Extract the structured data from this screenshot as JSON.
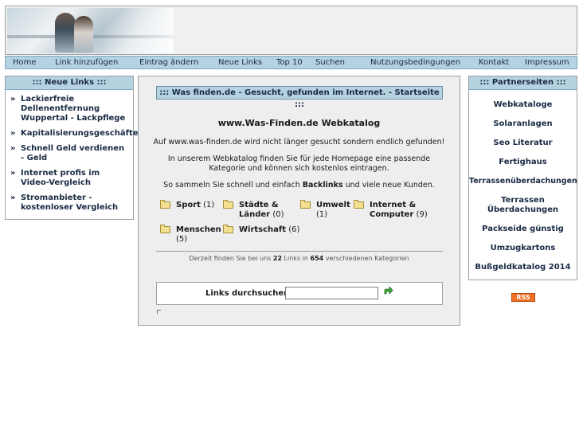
{
  "nav": {
    "items": [
      "Home",
      "Link hinzufügen",
      "Eintrag ändern",
      "Neue Links",
      "Top 10",
      "Suchen",
      "Nutzungsbedingungen",
      "Kontakt",
      "Impressum"
    ]
  },
  "left_panel": {
    "title": "::: Neue Links :::",
    "items": [
      "Lackierfreie Dellenentfernung Wuppertal - Lackpflege",
      "Kapitalisierungsgeschäfte",
      "Schnell Geld verdienen - Geld",
      "Internet profis im Video-Vergleich",
      "Stromanbieter - kostenloser Vergleich"
    ],
    "bullet": "»"
  },
  "main": {
    "title": "::: Was finden.de - Gesucht, gefunden im Internet. - Startseite :::",
    "heading": "www.Was-Finden.de Webkatalog",
    "intro": "Auf www.was-finden.de wird nicht länger gesucht sondern endlich gefunden!",
    "para1_line1": "In unserem Webkatalog finden Sie für jede Homepage eine passende",
    "para1_line2": "Kategorie und können sich kostenlos eintragen.",
    "para2_before": "So sammeln Sie schnell und einfach ",
    "para2_bold": "Backlinks",
    "para2_after": " und viele neue Kunden.",
    "categories": [
      {
        "name": "Sport",
        "count": "(1)"
      },
      {
        "name": "Städte & Länder",
        "count": "(0)"
      },
      {
        "name": "Umwelt",
        "count": "(1)"
      },
      {
        "name": "Internet & Computer",
        "count": "(9)"
      },
      {
        "name": "Menschen",
        "count": "(5)"
      },
      {
        "name": "Wirtschaft",
        "count": "(6)"
      }
    ],
    "stats": {
      "prefix": "Derzeit finden Sie bei uns ",
      "links": "22",
      "middle": " Links in ",
      "categories": "654",
      "suffix": " verschiedenen Kategorien"
    },
    "search": {
      "label": "Links durchsuchen",
      "value": "",
      "placeholder": "",
      "go_icon": "green-arrow-icon"
    }
  },
  "right_panel": {
    "title": "::: Partnerseiten :::",
    "items": [
      "Webkataloge",
      "Solaranlagen",
      "Seo Literatur",
      "Fertighaus",
      "Terrassenüberdachungen",
      "Terrassen Überdachungen",
      "Packseide günstig",
      "Umzugkartons",
      "Bußgeldkatalog 2014"
    ]
  },
  "rss": {
    "label": "RSS"
  },
  "colors": {
    "nav_bg": "#b5d2e0",
    "panel_border": "#9aa0a4",
    "center_bg": "#eeeeee",
    "rss": "#f07020"
  }
}
